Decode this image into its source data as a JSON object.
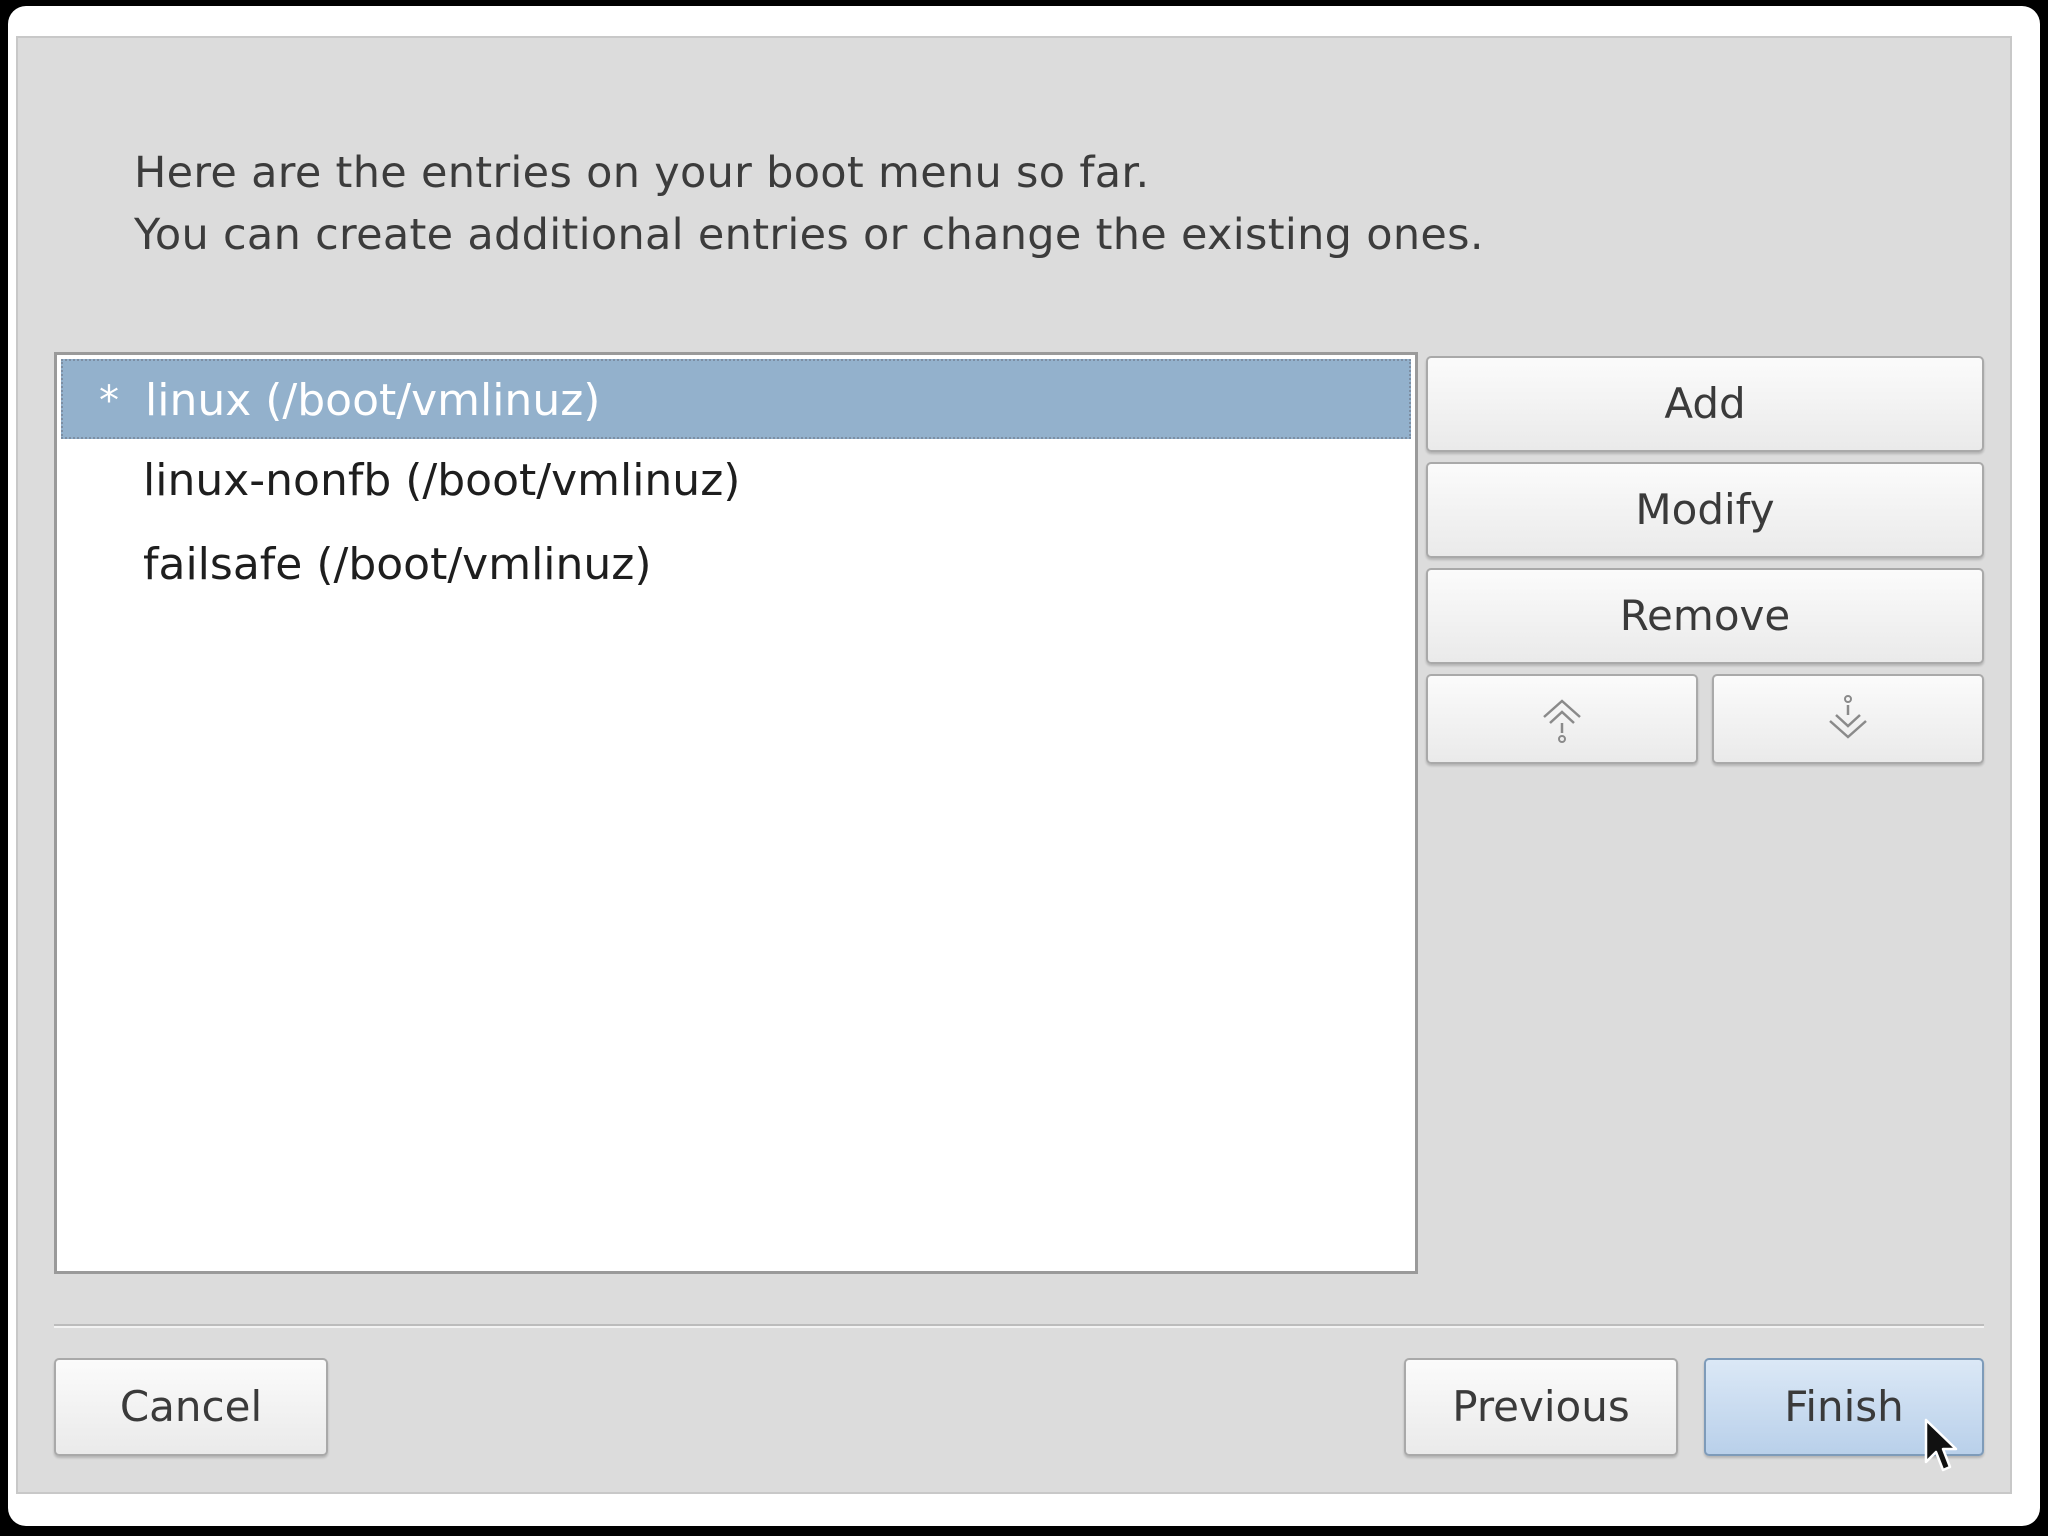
{
  "intro": {
    "line1": "Here are the entries on your boot menu so far.",
    "line2": "You can create additional entries or change the existing ones."
  },
  "entries": [
    {
      "marker": "*",
      "label": "linux (/boot/vmlinuz)",
      "selected": true
    },
    {
      "marker": "",
      "label": "linux-nonfb (/boot/vmlinuz)",
      "selected": false
    },
    {
      "marker": "",
      "label": "failsafe (/boot/vmlinuz)",
      "selected": false
    }
  ],
  "side_buttons": {
    "add": "Add",
    "modify": "Modify",
    "remove": "Remove",
    "move_up_icon": "move-up-arrow-icon",
    "move_down_icon": "move-down-arrow-icon"
  },
  "footer": {
    "cancel": "Cancel",
    "previous": "Previous",
    "finish": "Finish"
  },
  "colors": {
    "dialog_background": "#dcdcdc",
    "selection": "#93b1cc",
    "default_button": "#b9d0ea"
  }
}
